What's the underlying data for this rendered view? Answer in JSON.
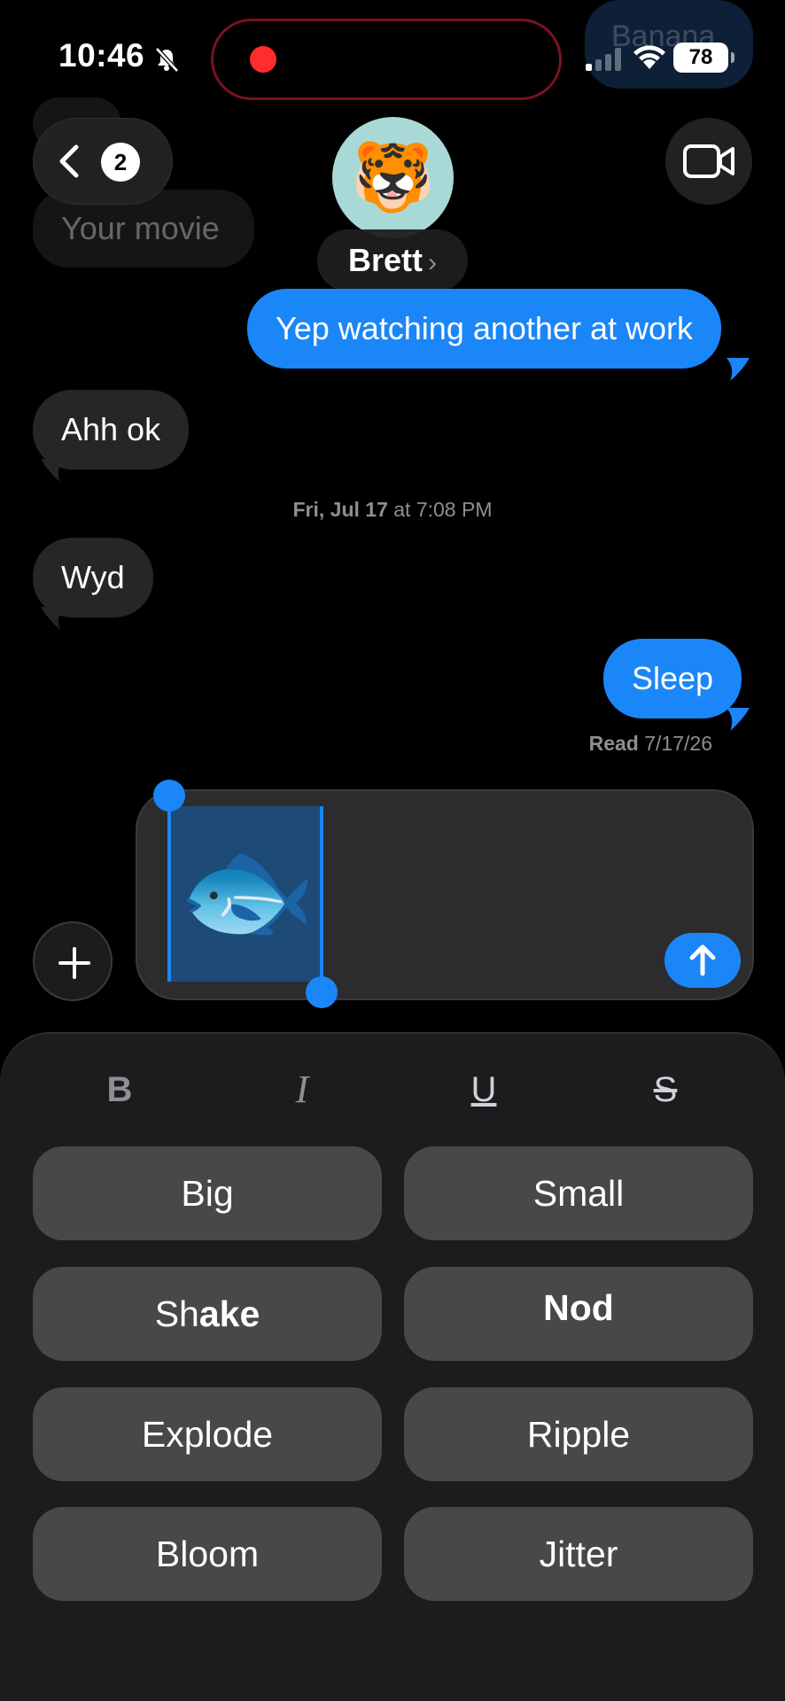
{
  "status_bar": {
    "time": "10:46",
    "battery": "78"
  },
  "ghosts": {
    "banana": "Banana",
    "movie": "Your movie"
  },
  "header": {
    "back_badge": "2",
    "contact_name": "Brett",
    "contact_chevron": "›",
    "avatar_emoji": "🐯"
  },
  "messages": [
    {
      "direction": "outgoing",
      "text": "Yep watching another at work"
    },
    {
      "direction": "incoming",
      "text": "Ahh ok"
    },
    {
      "direction": "incoming",
      "text": "Wyd"
    },
    {
      "direction": "outgoing",
      "text": "Sleep"
    }
  ],
  "timestamp": {
    "day": "Fri, Jul 17",
    "time": "at 7:08 PM"
  },
  "read_receipt": {
    "label": "Read",
    "date": "7/17/26"
  },
  "compose": {
    "content_emoji": "🐟"
  },
  "format_buttons": {
    "bold": "B",
    "italic": "I",
    "underline": "U",
    "strike": "S"
  },
  "effects": {
    "big": "Big",
    "small": "Small",
    "shake_a": "Sh",
    "shake_b": "ake",
    "nod": "Nod",
    "explode": "Explode",
    "ripple": "Ripple",
    "bloom": "Bloom",
    "jitter": "Jitter"
  },
  "colors": {
    "accent": "#1b86f7",
    "incoming_bubble": "#262628",
    "recording": "#ff2d2d"
  }
}
